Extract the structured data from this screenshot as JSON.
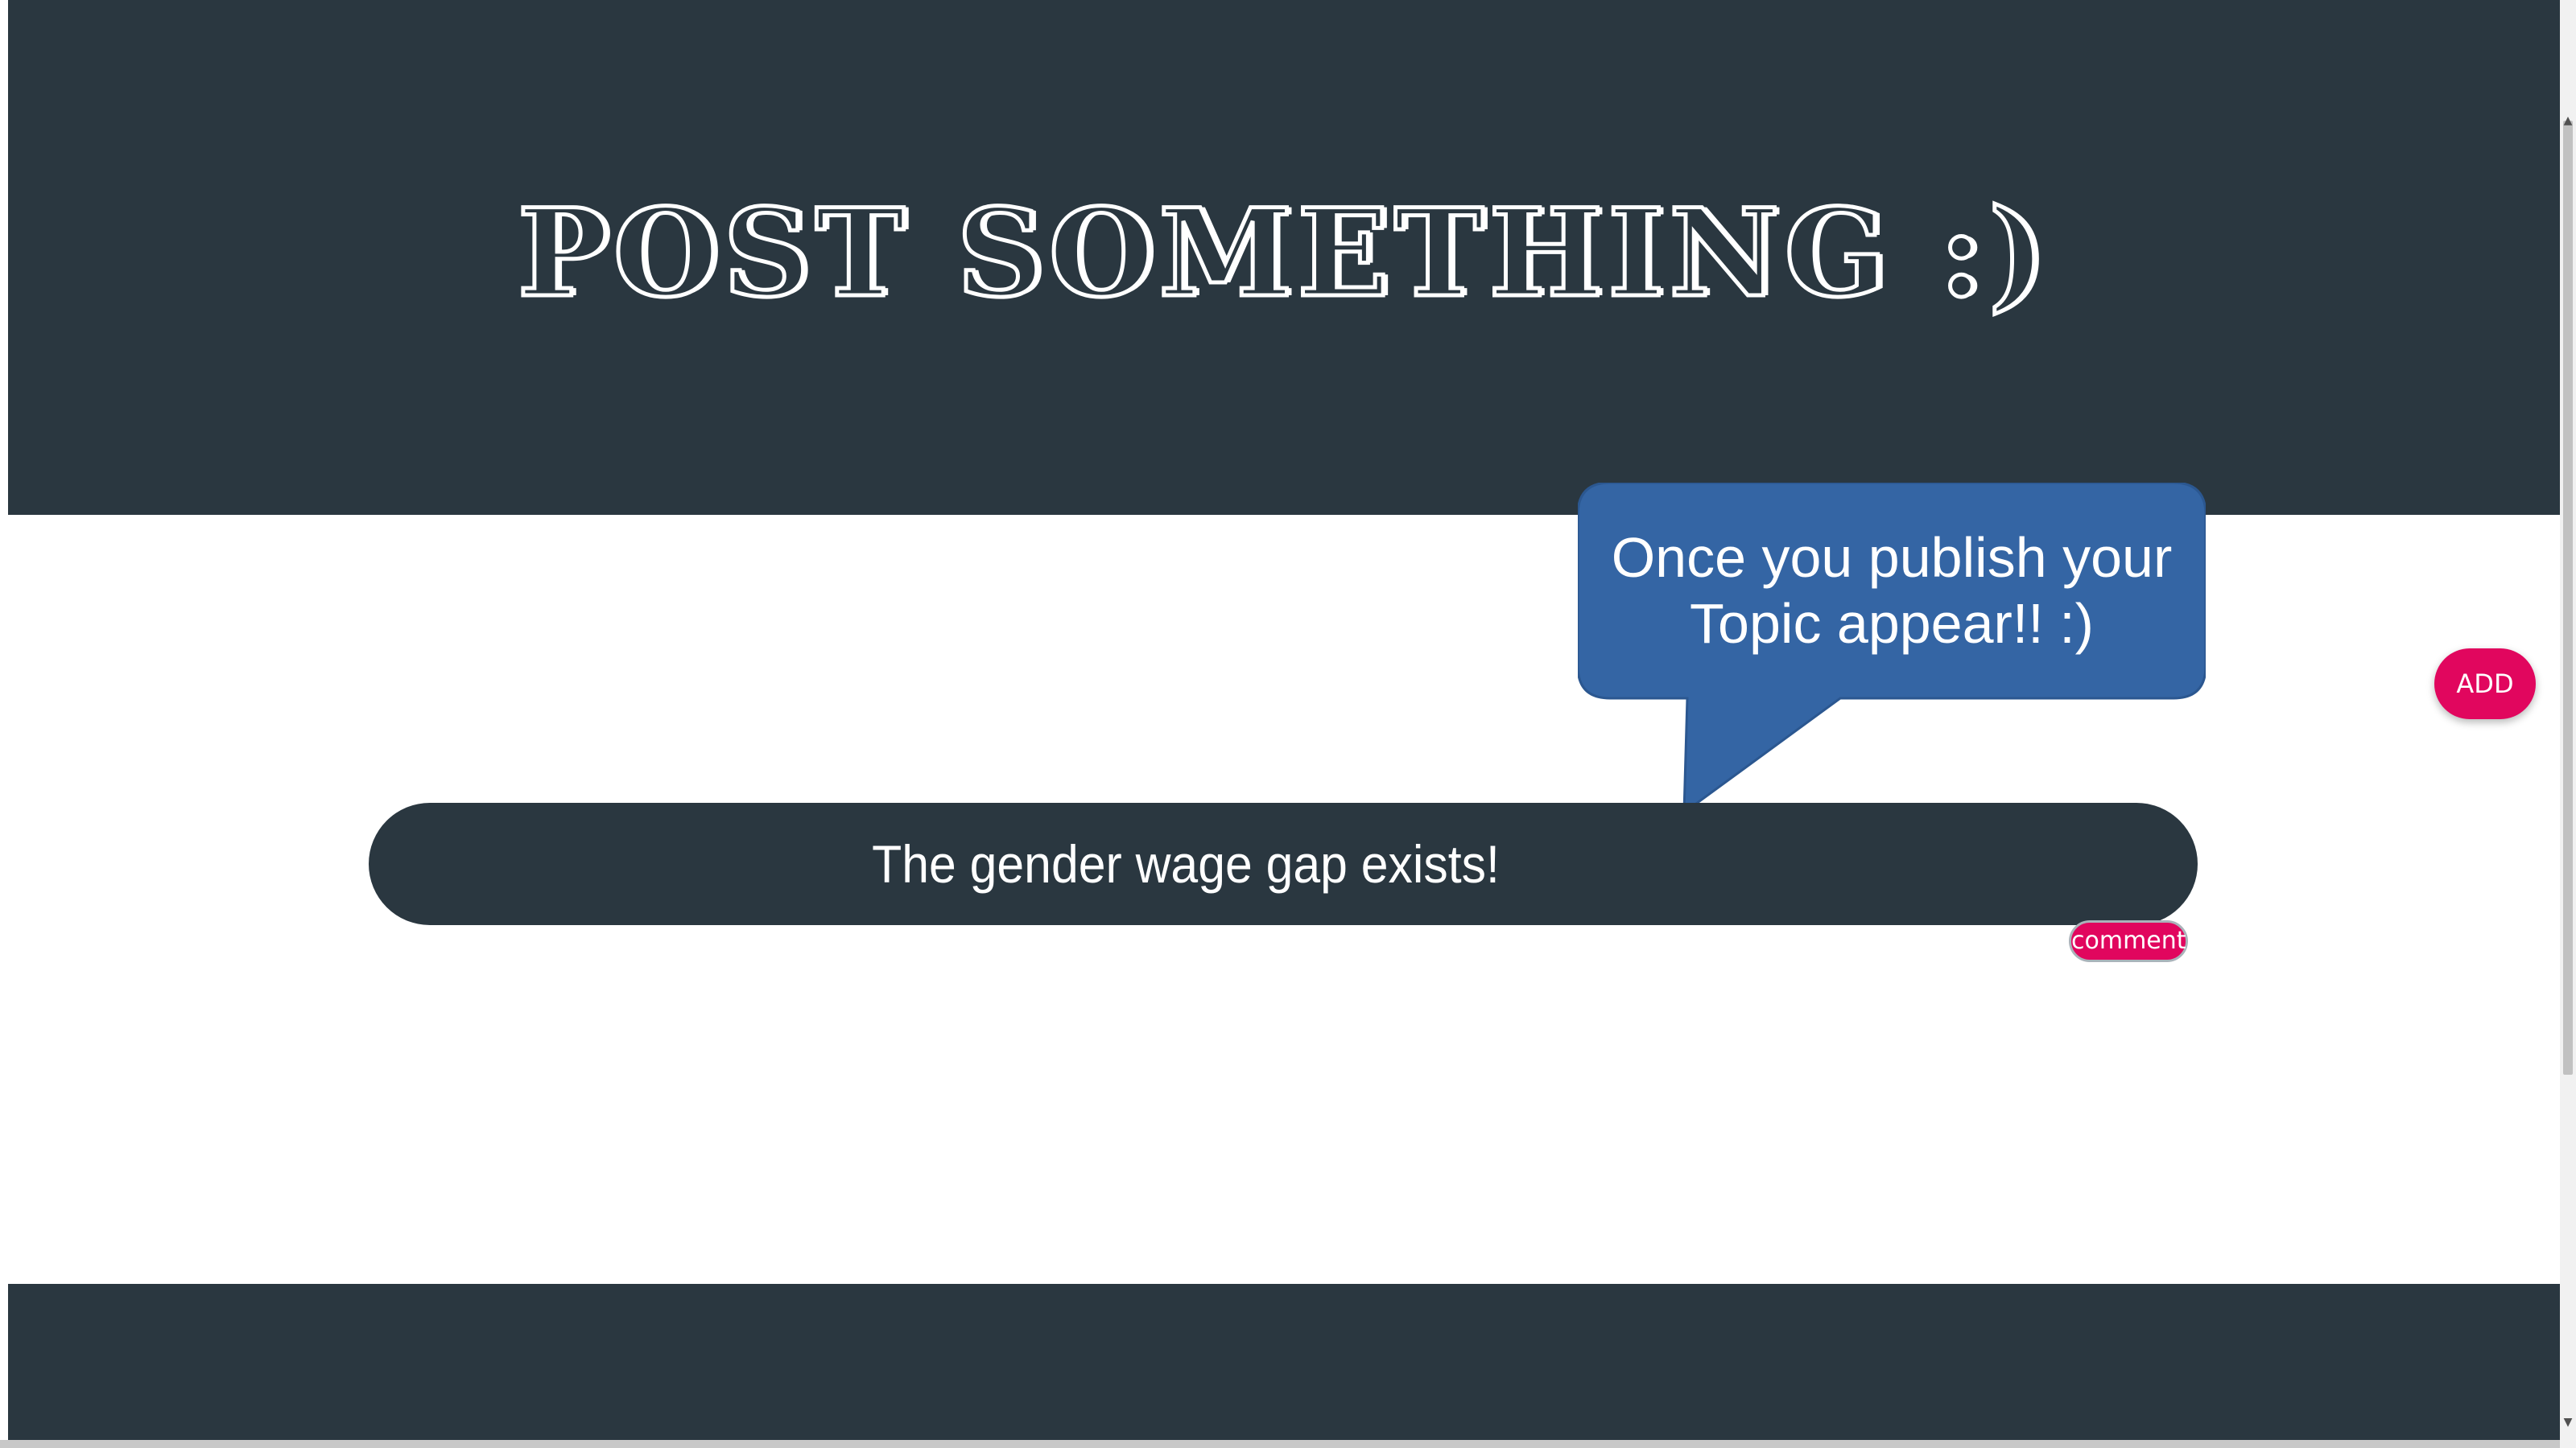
{
  "header": {
    "title": "POST SOMETHING :)"
  },
  "tooltip": {
    "text": "Once you publish your Topic appear!! :)"
  },
  "topics": [
    {
      "text": "The gender wage gap exists!",
      "comment_label": "comment"
    }
  ],
  "actions": {
    "add_label": "ADD"
  },
  "colors": {
    "header_bg": "#2a3740",
    "accent": "#e1065e",
    "bubble": "#3465a4",
    "text": "#ffffff"
  },
  "icons": {
    "scroll_up": "scroll-up-arrow-icon",
    "scroll_down": "scroll-down-arrow-icon"
  }
}
